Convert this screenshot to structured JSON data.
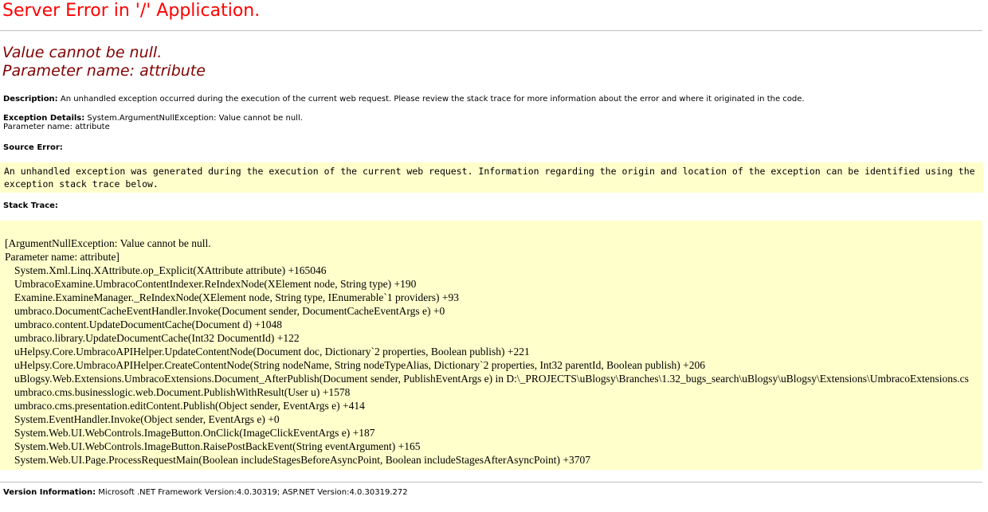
{
  "header": {
    "title": "Server Error in '/' Application."
  },
  "error": {
    "message_line1": "Value cannot be null.",
    "message_line2": "Parameter name: attribute"
  },
  "description": {
    "label": "Description:",
    "text": " An unhandled exception occurred during the execution of the current web request. Please review the stack trace for more information about the error and where it originated in the code."
  },
  "exception_details": {
    "label": "Exception Details:",
    "text": " System.ArgumentNullException: Value cannot be null.",
    "line2": "Parameter name: attribute"
  },
  "source_error": {
    "label": "Source Error:",
    "text": "An unhandled exception was generated during the execution of the current web request. Information regarding the origin and location of the exception can be identified using the exception stack trace below."
  },
  "stack_trace": {
    "label": "Stack Trace:",
    "header_lines": [
      "[ArgumentNullException: Value cannot be null.",
      "Parameter name: attribute]"
    ],
    "frames": [
      "System.Xml.Linq.XAttribute.op_Explicit(XAttribute attribute) +165046",
      "UmbracoExamine.UmbracoContentIndexer.ReIndexNode(XElement node, String type) +190",
      "Examine.ExamineManager._ReIndexNode(XElement node, String type, IEnumerable`1 providers) +93",
      "umbraco.DocumentCacheEventHandler.Invoke(Document sender, DocumentCacheEventArgs e) +0",
      "umbraco.content.UpdateDocumentCache(Document d) +1048",
      "umbraco.library.UpdateDocumentCache(Int32 DocumentId) +122",
      "uHelpsy.Core.UmbracoAPIHelper.UpdateContentNode(Document doc, Dictionary`2 properties, Boolean publish) +221",
      "uHelpsy.Core.UmbracoAPIHelper.CreateContentNode(String nodeName, String nodeTypeAlias, Dictionary`2 properties, Int32 parentId, Boolean publish) +206",
      "uBlogsy.Web.Extensions.UmbracoExtensions.Document_AfterPublish(Document sender, PublishEventArgs e) in D:\\_PROJECTS\\uBlogsy\\Branches\\1.32_bugs_search\\uBlogsy\\uBlogsy\\Extensions\\UmbracoExtensions.cs",
      "umbraco.cms.businesslogic.web.Document.PublishWithResult(User u) +1578",
      "umbraco.cms.presentation.editContent.Publish(Object sender, EventArgs e) +414",
      "System.EventHandler.Invoke(Object sender, EventArgs e) +0",
      "System.Web.UI.WebControls.ImageButton.OnClick(ImageClickEventArgs e) +187",
      "System.Web.UI.WebControls.ImageButton.RaisePostBackEvent(String eventArgument) +165",
      "System.Web.UI.Page.ProcessRequestMain(Boolean includeStagesBeforeAsyncPoint, Boolean includeStagesAfterAsyncPoint) +3707"
    ]
  },
  "version_info": {
    "label": "Version Information:",
    "text": " Microsoft .NET Framework Version:4.0.30319; ASP.NET Version:4.0.30319.272"
  },
  "colors": {
    "title": "#ff0000",
    "message": "#800000",
    "code_background": "#ffffcc",
    "rule": "#c0c0c0"
  }
}
